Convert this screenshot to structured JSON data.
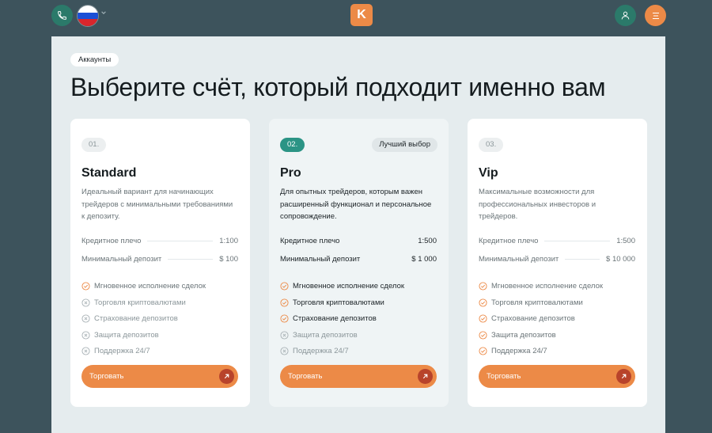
{
  "header": {
    "logo_letter": "K",
    "icons": [
      "phone-icon",
      "russia-flag-icon",
      "chevron-down-icon",
      "user-icon",
      "menu-icon"
    ],
    "colors": {
      "accent": "#ec8a47",
      "green": "#2b7a6a",
      "background": "#3d535c",
      "panel": "#e5ecee"
    }
  },
  "page": {
    "breadcrumb": "Аккаунты",
    "headline": "Выберите счёт, который подходит именно вам"
  },
  "cards": [
    {
      "number": "01.",
      "badge": "",
      "title": "Standard",
      "description": "Идеальный вариант для начинающих трейдеров с минимальными требованиями к депозиту.",
      "specs": [
        {
          "label": "Кредитное плечо",
          "value": "1:100"
        },
        {
          "label": "Минимальный депозит",
          "value": "$ 100"
        }
      ],
      "features": [
        {
          "label": "Мгновенное исполнение сделок",
          "included": true
        },
        {
          "label": "Торговля криптовалютами",
          "included": false
        },
        {
          "label": "Страхование депозитов",
          "included": false
        },
        {
          "label": "Защита депозитов",
          "included": false
        },
        {
          "label": "Поддержка 24/7",
          "included": false
        }
      ],
      "button": "Торговать"
    },
    {
      "number": "02.",
      "badge": "Лучший выбор",
      "title": "Pro",
      "description": "Для опытных трейдеров, которым важен расширенный функционал и персональное сопровождение.",
      "specs": [
        {
          "label": "Кредитное плечо",
          "value": "1:500"
        },
        {
          "label": "Минимальный депозит",
          "value": "$ 1 000"
        }
      ],
      "features": [
        {
          "label": "Мгновенное исполнение сделок",
          "included": true
        },
        {
          "label": "Торговля криптовалютами",
          "included": true
        },
        {
          "label": "Страхование депозитов",
          "included": true
        },
        {
          "label": "Защита депозитов",
          "included": false
        },
        {
          "label": "Поддержка 24/7",
          "included": false
        }
      ],
      "button": "Торговать"
    },
    {
      "number": "03.",
      "badge": "",
      "title": "Vip",
      "description": "Максимальные возможности для профессиональных инвесторов и трейдеров.",
      "specs": [
        {
          "label": "Кредитное плечо",
          "value": "1:500"
        },
        {
          "label": "Минимальный депозит",
          "value": "$ 10 000"
        }
      ],
      "features": [
        {
          "label": "Мгновенное исполнение сделок",
          "included": true
        },
        {
          "label": "Торговля криптовалютами",
          "included": true
        },
        {
          "label": "Страхование депозитов",
          "included": true
        },
        {
          "label": "Защита депозитов",
          "included": true
        },
        {
          "label": "Поддержка 24/7",
          "included": true
        }
      ],
      "button": "Торговать"
    }
  ]
}
